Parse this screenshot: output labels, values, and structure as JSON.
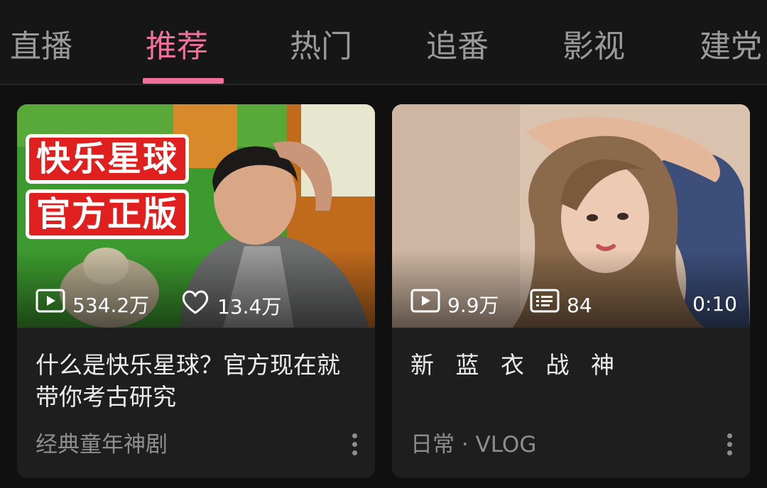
{
  "tabs": [
    {
      "label": "直播"
    },
    {
      "label": "推荐",
      "active": true
    },
    {
      "label": "热门"
    },
    {
      "label": "追番"
    },
    {
      "label": "影视"
    },
    {
      "label": "建党"
    }
  ],
  "colors": {
    "accent": "#f0729a",
    "background": "#101010",
    "card": "#1e1e1e",
    "secondary_text": "#8e8e8e"
  },
  "cards": [
    {
      "thumbnail_banner": [
        "快乐星球",
        "官方正版"
      ],
      "views": "534.2万",
      "views_icon": "play-icon",
      "likes": "13.4万",
      "likes_icon": "heart-icon",
      "title": "什么是快乐星球？官方现在就带你考古研究",
      "subtitle": "经典童年神剧",
      "menu_icon": "more-vertical-icon"
    },
    {
      "views": "9.9万",
      "views_icon": "play-icon",
      "danmaku": "84",
      "danmaku_icon": "danmaku-icon",
      "duration": "0:10",
      "title": "新 蓝 衣 战 神",
      "subtitle": "日常 · VLOG",
      "menu_icon": "more-vertical-icon"
    }
  ]
}
